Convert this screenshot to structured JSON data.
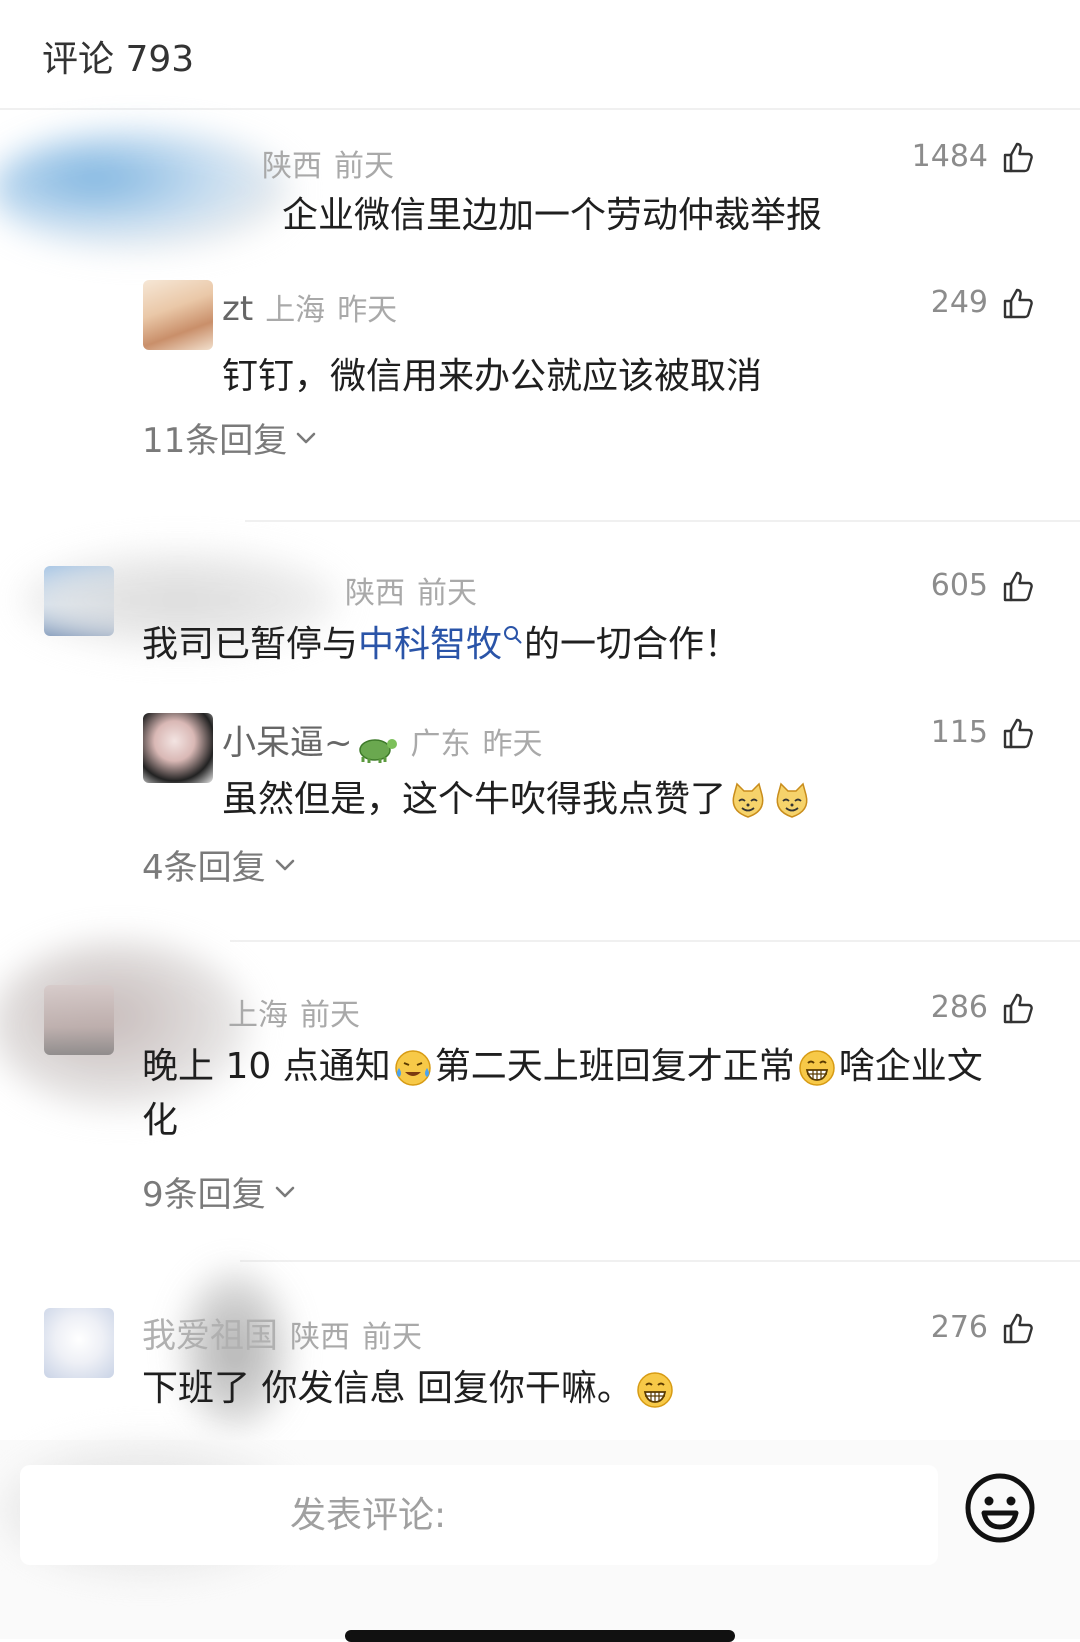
{
  "header": {
    "title": "评论 793"
  },
  "comments": [
    {
      "location": "陕西",
      "time": "前天",
      "likes": "1484",
      "text": "企业微信里边加一个劳动仲裁举报",
      "reply": {
        "user": "zt",
        "location": "上海",
        "time": "昨天",
        "likes": "249",
        "text": "钉钉，微信用来办公就应该被取消"
      },
      "reply_count": "11条回复"
    },
    {
      "location": "陕西",
      "time": "前天",
      "likes": "605",
      "text_before": "我司已暂停与",
      "link": "中科智牧",
      "text_after": "的一切合作！",
      "reply": {
        "user": "小呆逼~",
        "location": "广东",
        "time": "昨天",
        "likes": "115",
        "text": "虽然但是，这个牛吹得我点赞了"
      },
      "reply_count": "4条回复"
    },
    {
      "location": "上海",
      "time": "前天",
      "likes": "286",
      "text_p1": "晚上 10 点通知",
      "text_p2": "第二天上班回复才正常",
      "text_p3": "啥企业文",
      "text_p4": "化",
      "reply_count": "9条回复"
    },
    {
      "user": "我爱祖国",
      "location": "陕西",
      "time": "前天",
      "likes": "276",
      "text": "下班了 你发信息 回复你干嘛。"
    }
  ],
  "input": {
    "placeholder": "发表评论:"
  },
  "icons": {
    "like": "thumbs-up-icon",
    "expand": "chevron-down-icon",
    "emoji": "smiley-face-icon",
    "search": "search-icon"
  },
  "colors": {
    "link": "#2a54a8",
    "meta": "#a9a9a9",
    "text": "#1f1f1f"
  }
}
